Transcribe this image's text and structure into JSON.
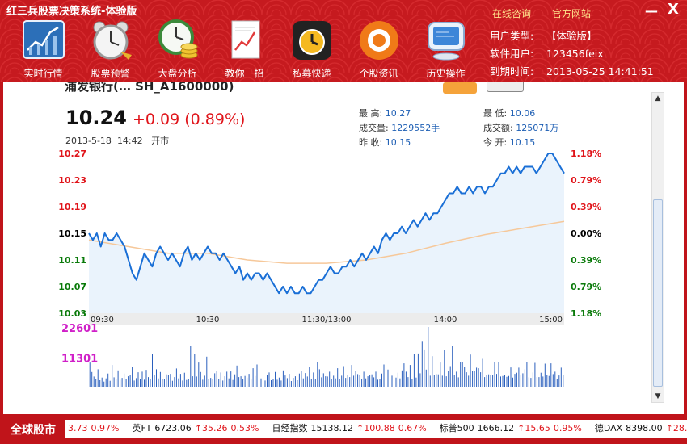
{
  "app": {
    "title": "红三兵股票决策系统-体验版",
    "consult_link": "在线咨询",
    "website_link": "官方网站",
    "minimize": "—",
    "close": "X"
  },
  "toolbar": [
    {
      "label": "实时行情",
      "icon": "chart-board-icon"
    },
    {
      "label": "股票预警",
      "icon": "alarm-clock-icon"
    },
    {
      "label": "大盘分析",
      "icon": "clock-coins-icon"
    },
    {
      "label": "教你一招",
      "icon": "document-chart-icon"
    },
    {
      "label": "私募快递",
      "icon": "alarm-timer-icon"
    },
    {
      "label": "个股资讯",
      "icon": "target-disc-icon"
    },
    {
      "label": "历史操作",
      "icon": "computer-monitor-icon"
    }
  ],
  "account": {
    "type_label": "用户类型:",
    "type_value": "【体验版】",
    "user_label": "软件用户:",
    "user_value": "123456feix",
    "expire_label": "到期时间:",
    "expire_value": "2013-05-25 14:41:51"
  },
  "stock": {
    "name": "浦发银行(… SH_A1600000)",
    "price": "10.24",
    "change": "+0.09 (0.89%)",
    "date": "2013-5-18",
    "time": "14:42",
    "session": "开市",
    "stats": [
      {
        "label": "最  高:",
        "value": "10.27"
      },
      {
        "label": "成交量:",
        "value": "1229552手"
      },
      {
        "label": "昨  收:",
        "value": "10.15"
      },
      {
        "label": "最  低:",
        "value": "10.06"
      },
      {
        "label": "成交额:",
        "value": "125071万"
      },
      {
        "label": "今  开:",
        "value": "10.15"
      }
    ]
  },
  "colors": {
    "up": "#e0141a",
    "down": "#0a7a0a",
    "neutral": "#000000",
    "price_line": "#1a6fd6",
    "avg_line": "#f6c89a",
    "volume": "#2a5fbd",
    "volume_label": "#d01fc8",
    "header_bg": "#c61a1f"
  },
  "chart_data": {
    "type": "line",
    "title": "",
    "x_ticks": [
      "09:30",
      "10:30",
      "11:30/13:00",
      "14:00",
      "15:00"
    ],
    "y_left_ticks": [
      "10.27",
      "10.23",
      "10.19",
      "10.15",
      "10.11",
      "10.07",
      "10.03"
    ],
    "y_right_ticks": [
      "1.18%",
      "0.79%",
      "0.39%",
      "0.00%",
      "0.39%",
      "0.79%",
      "1.18%"
    ],
    "ylim": [
      10.03,
      10.27
    ],
    "prev_close": 10.15,
    "x_range": [
      0,
      240
    ],
    "price_series": [
      [
        0,
        10.15
      ],
      [
        2,
        10.14
      ],
      [
        4,
        10.15
      ],
      [
        6,
        10.13
      ],
      [
        8,
        10.15
      ],
      [
        10,
        10.14
      ],
      [
        12,
        10.14
      ],
      [
        14,
        10.15
      ],
      [
        16,
        10.14
      ],
      [
        18,
        10.13
      ],
      [
        20,
        10.11
      ],
      [
        22,
        10.09
      ],
      [
        24,
        10.08
      ],
      [
        26,
        10.1
      ],
      [
        28,
        10.12
      ],
      [
        30,
        10.11
      ],
      [
        32,
        10.1
      ],
      [
        34,
        10.12
      ],
      [
        36,
        10.13
      ],
      [
        38,
        10.12
      ],
      [
        40,
        10.11
      ],
      [
        42,
        10.12
      ],
      [
        44,
        10.11
      ],
      [
        46,
        10.1
      ],
      [
        48,
        10.12
      ],
      [
        50,
        10.13
      ],
      [
        52,
        10.11
      ],
      [
        54,
        10.12
      ],
      [
        56,
        10.11
      ],
      [
        58,
        10.12
      ],
      [
        60,
        10.13
      ],
      [
        62,
        10.12
      ],
      [
        64,
        10.12
      ],
      [
        66,
        10.11
      ],
      [
        68,
        10.12
      ],
      [
        70,
        10.11
      ],
      [
        72,
        10.1
      ],
      [
        74,
        10.09
      ],
      [
        76,
        10.1
      ],
      [
        78,
        10.08
      ],
      [
        80,
        10.09
      ],
      [
        82,
        10.08
      ],
      [
        84,
        10.09
      ],
      [
        86,
        10.09
      ],
      [
        88,
        10.08
      ],
      [
        90,
        10.09
      ],
      [
        92,
        10.08
      ],
      [
        94,
        10.07
      ],
      [
        96,
        10.06
      ],
      [
        98,
        10.07
      ],
      [
        100,
        10.06
      ],
      [
        102,
        10.07
      ],
      [
        104,
        10.06
      ],
      [
        106,
        10.06
      ],
      [
        108,
        10.07
      ],
      [
        110,
        10.06
      ],
      [
        112,
        10.06
      ],
      [
        114,
        10.07
      ],
      [
        116,
        10.08
      ],
      [
        118,
        10.08
      ],
      [
        120,
        10.09
      ],
      [
        122,
        10.1
      ],
      [
        124,
        10.09
      ],
      [
        126,
        10.09
      ],
      [
        128,
        10.1
      ],
      [
        130,
        10.1
      ],
      [
        132,
        10.11
      ],
      [
        134,
        10.1
      ],
      [
        136,
        10.11
      ],
      [
        138,
        10.12
      ],
      [
        140,
        10.11
      ],
      [
        142,
        10.12
      ],
      [
        144,
        10.13
      ],
      [
        146,
        10.12
      ],
      [
        148,
        10.14
      ],
      [
        150,
        10.15
      ],
      [
        152,
        10.14
      ],
      [
        154,
        10.15
      ],
      [
        156,
        10.15
      ],
      [
        158,
        10.16
      ],
      [
        160,
        10.15
      ],
      [
        162,
        10.16
      ],
      [
        164,
        10.17
      ],
      [
        166,
        10.16
      ],
      [
        168,
        10.17
      ],
      [
        170,
        10.18
      ],
      [
        172,
        10.17
      ],
      [
        174,
        10.18
      ],
      [
        176,
        10.18
      ],
      [
        178,
        10.19
      ],
      [
        180,
        10.2
      ],
      [
        182,
        10.21
      ],
      [
        184,
        10.21
      ],
      [
        186,
        10.22
      ],
      [
        188,
        10.21
      ],
      [
        190,
        10.21
      ],
      [
        192,
        10.22
      ],
      [
        194,
        10.21
      ],
      [
        196,
        10.22
      ],
      [
        198,
        10.22
      ],
      [
        200,
        10.21
      ],
      [
        202,
        10.22
      ],
      [
        204,
        10.22
      ],
      [
        206,
        10.23
      ],
      [
        208,
        10.24
      ],
      [
        210,
        10.24
      ],
      [
        212,
        10.25
      ],
      [
        214,
        10.24
      ],
      [
        216,
        10.25
      ],
      [
        218,
        10.24
      ],
      [
        220,
        10.25
      ],
      [
        222,
        10.25
      ],
      [
        224,
        10.25
      ],
      [
        226,
        10.24
      ],
      [
        228,
        10.25
      ],
      [
        230,
        10.26
      ],
      [
        232,
        10.27
      ],
      [
        234,
        10.27
      ],
      [
        236,
        10.26
      ],
      [
        238,
        10.25
      ],
      [
        240,
        10.24
      ]
    ],
    "avg_series": [
      [
        0,
        10.14
      ],
      [
        20,
        10.13
      ],
      [
        40,
        10.12
      ],
      [
        60,
        10.12
      ],
      [
        80,
        10.11
      ],
      [
        100,
        10.105
      ],
      [
        120,
        10.105
      ],
      [
        140,
        10.11
      ],
      [
        160,
        10.12
      ],
      [
        180,
        10.135
      ],
      [
        200,
        10.148
      ],
      [
        220,
        10.158
      ],
      [
        240,
        10.168
      ]
    ],
    "volume_ticks": [
      "22601",
      "11301"
    ],
    "volume_max": 22601,
    "volumes": [
      9300,
      5800,
      4100,
      3200,
      6800,
      2700,
      3700,
      2200,
      3400,
      5200,
      2500,
      8400,
      3800,
      3300,
      6400,
      2900,
      3600,
      5200,
      3100,
      4200,
      4600,
      7700,
      2600,
      3500,
      5700,
      3100,
      5900,
      2900,
      6600,
      3900,
      3300,
      12400,
      4700,
      6800,
      3400,
      5800,
      3000,
      3100,
      4900,
      4700,
      5100,
      2500,
      3900,
      7100,
      3400,
      5100,
      2600,
      5500,
      2800,
      3000,
      15400,
      4200,
      12400,
      4100,
      9300,
      5800,
      2900,
      4400,
      11500,
      3000,
      3600,
      3300,
      5300,
      6300,
      3100,
      5600,
      2600,
      4200,
      5900,
      3400,
      6000,
      2800,
      4900,
      8200,
      3900,
      4200,
      3200,
      4300,
      3700,
      5100,
      3000,
      7200,
      4300,
      8600,
      2900,
      3400,
      6000,
      2600,
      4700,
      5600,
      2700,
      3100,
      5800,
      2900,
      3700,
      2600,
      6400,
      4500,
      3500,
      5100,
      2400,
      3600,
      4200,
      2700,
      5200,
      6200,
      3400,
      5400,
      4100,
      7800,
      3100,
      5600,
      3000,
      9600,
      6800,
      3800,
      5300,
      4200,
      4100,
      5900,
      3000,
      4400,
      3400,
      7200,
      3100,
      4400,
      8000,
      3600,
      4700,
      3900,
      8400,
      4400,
      6300,
      5000,
      4600,
      3200,
      5900,
      3400,
      4200,
      4600,
      4900,
      3800,
      5900,
      2900,
      3300,
      5200,
      8600,
      3400,
      6700,
      13300,
      4400,
      5900,
      3700,
      5500,
      3400,
      6400,
      9000,
      5900,
      3900,
      8400,
      3000,
      12500,
      3700,
      12700,
      5300,
      17100,
      14200,
      6700,
      22600,
      4400,
      11700,
      4800,
      5000,
      4900,
      9300,
      4400,
      14100,
      4200,
      6300,
      8000,
      15500,
      4600,
      5900,
      3800,
      9600,
      9600,
      7700,
      5700,
      4400,
      12300,
      6200,
      6300,
      7400,
      7200,
      5700,
      10700,
      3900,
      4600,
      4900,
      4800,
      4700,
      9500,
      5100,
      9500,
      4100,
      4300,
      4600,
      4000,
      4300,
      7500,
      3700,
      5100,
      5500,
      7400,
      4500,
      5300,
      6800,
      9500,
      3800,
      3600,
      5600,
      9200,
      3900,
      3900,
      5500,
      4100,
      8900,
      4600,
      4300,
      9000,
      5000,
      5900,
      3300,
      4500,
      7400,
      4800
    ]
  },
  "ticker": {
    "label": "全球股市",
    "items": [
      {
        "name": "",
        "value": "",
        "change": "3.73",
        "pct": "0.97%"
      },
      {
        "name": "英FT",
        "value": "6723.06",
        "change": "↑35.26",
        "pct": "0.53%"
      },
      {
        "name": "日经指数",
        "value": "15138.12",
        "change": "↑100.88",
        "pct": "0.67%"
      },
      {
        "name": "标普500",
        "value": "1666.12",
        "change": "↑15.65",
        "pct": "0.95%"
      },
      {
        "name": "德DAX",
        "value": "8398.00",
        "change": "↑28.",
        "pct": ""
      }
    ]
  },
  "scroll": {
    "up": "▲",
    "down": "▼",
    "grip": "≡"
  }
}
